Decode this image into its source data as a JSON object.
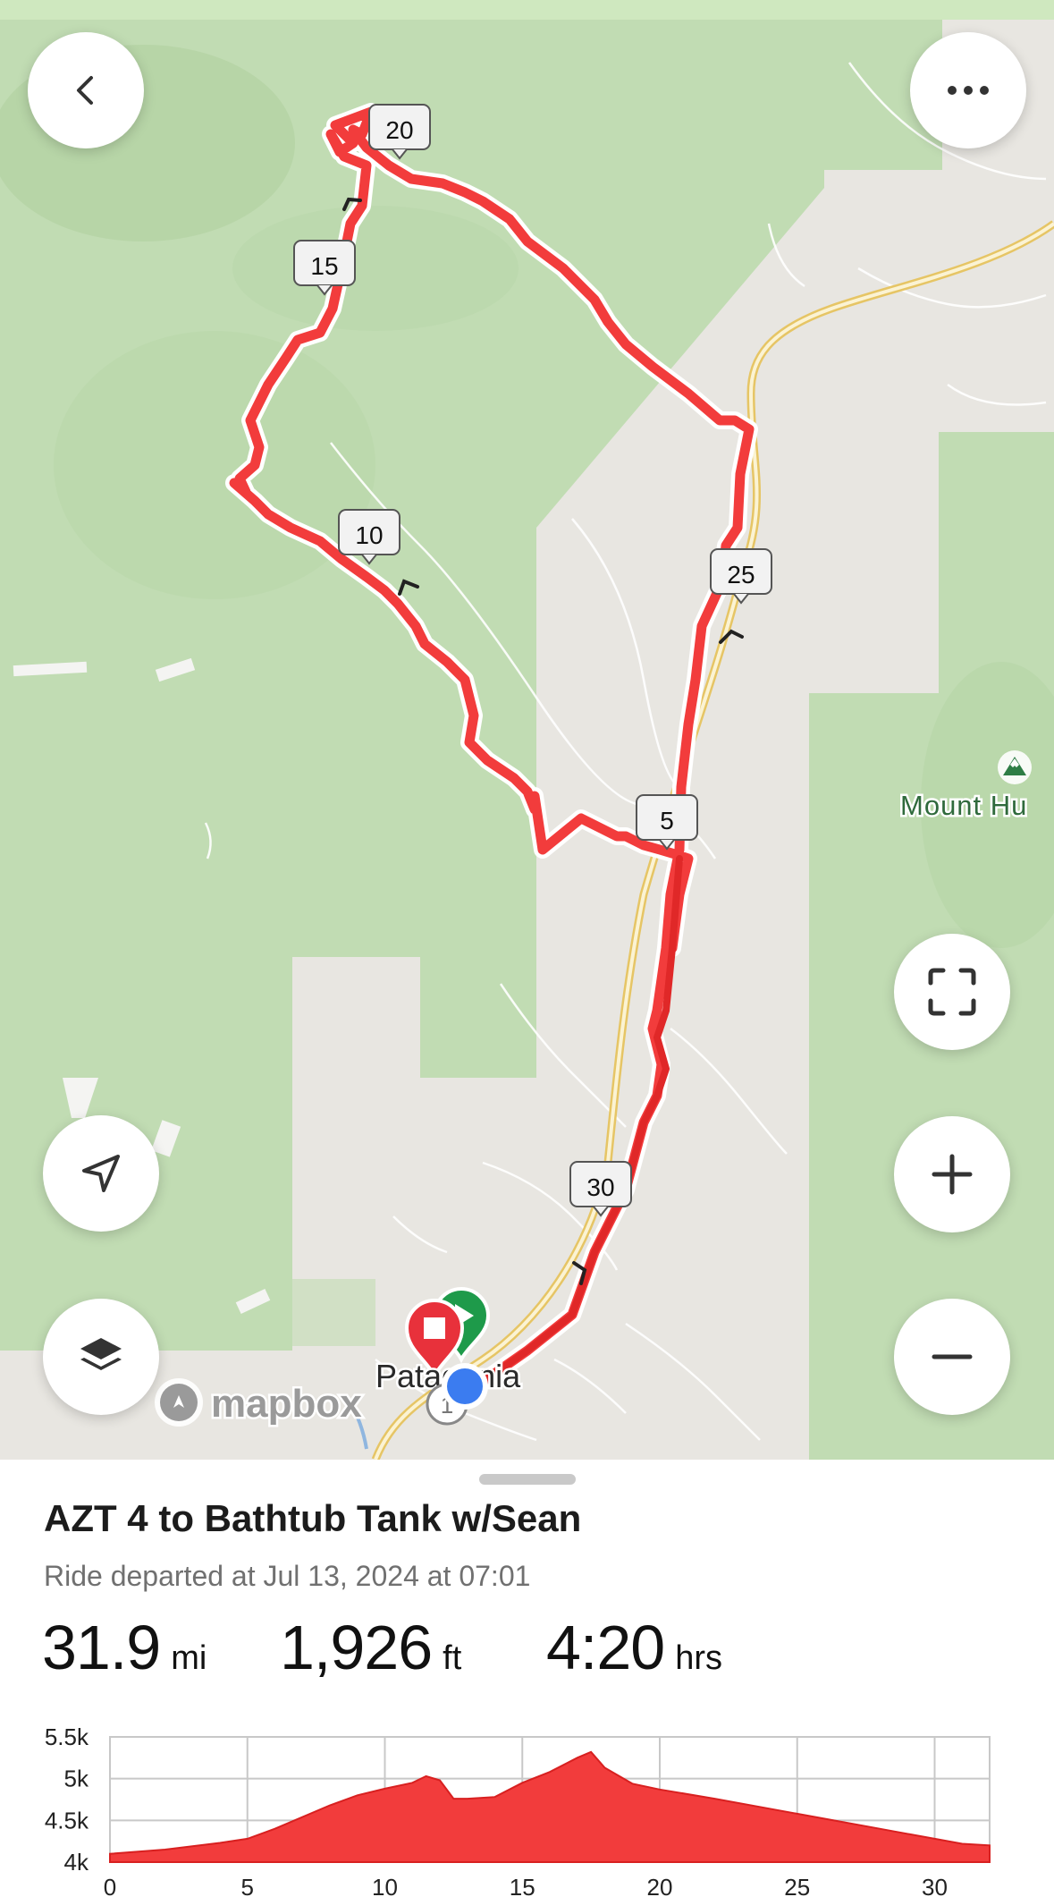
{
  "map": {
    "attribution": "mapbox",
    "place_label": "Patagonia",
    "peak_label": "Mount Hu",
    "highway_shield": "1",
    "mile_markers": [
      "5",
      "10",
      "15",
      "20",
      "25",
      "30"
    ]
  },
  "controls": {
    "back": "chevron-left-icon",
    "more": "more-horizontal-icon",
    "locate": "navigation-arrow-icon",
    "layers": "layers-icon",
    "fullscreen": "fullscreen-icon",
    "zoom_in": "plus-icon",
    "zoom_out": "minus-icon"
  },
  "ride": {
    "title": "AZT 4 to Bathtub Tank w/Sean",
    "subtitle": "Ride departed at Jul 13, 2024 at 07:01",
    "distance_value": "31.9",
    "distance_unit": "mi",
    "elevation_value": "1,926",
    "elevation_unit": "ft",
    "duration_value": "4:20",
    "duration_unit": "hrs"
  },
  "colors": {
    "route": "#f23c3c",
    "forest": "#bfdcb1",
    "land": "#e8e6e1",
    "start": "#1e9a4a",
    "end": "#e8313b",
    "current": "#3b7cf0"
  },
  "chart_data": {
    "type": "area",
    "xlabel": "",
    "ylabel": "",
    "x_ticks": [
      0,
      5,
      10,
      15,
      20,
      25,
      30
    ],
    "y_ticks": [
      "4k",
      "4.5k",
      "5k",
      "5.5k"
    ],
    "xlim": [
      0,
      32
    ],
    "ylim": [
      4000,
      5500
    ],
    "grid": true,
    "series": [
      {
        "x": [
          0,
          2,
          4,
          5,
          6,
          8,
          9,
          10,
          11,
          11.5,
          12,
          12.5,
          13,
          14,
          15,
          16,
          17,
          17.5,
          18,
          19,
          20,
          22,
          24,
          26,
          28,
          30,
          31,
          32
        ],
        "y": [
          4100,
          4150,
          4230,
          4280,
          4400,
          4680,
          4800,
          4880,
          4950,
          5030,
          4980,
          4760,
          4760,
          4780,
          4950,
          5080,
          5250,
          5320,
          5130,
          4940,
          4870,
          4760,
          4640,
          4520,
          4400,
          4280,
          4220,
          4200
        ]
      }
    ]
  }
}
